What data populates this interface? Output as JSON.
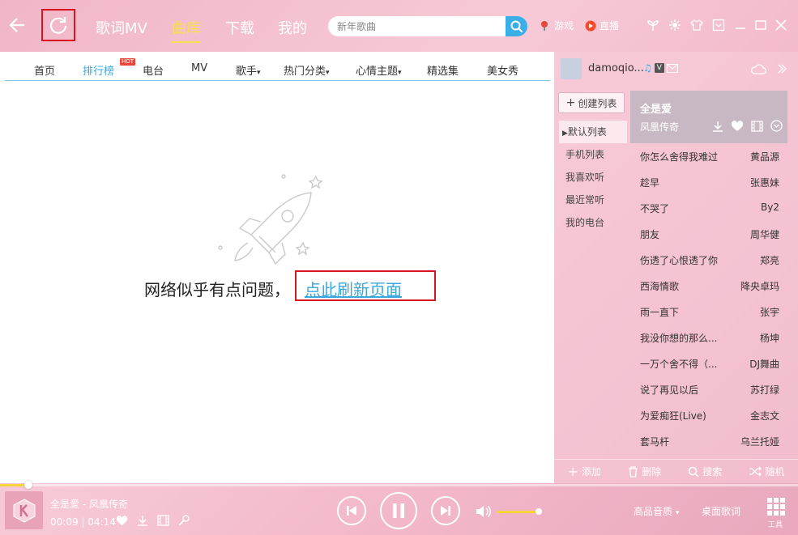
{
  "nav": {
    "tabs": [
      {
        "label": "歌词MV"
      },
      {
        "label": "曲库"
      },
      {
        "label": "下载"
      },
      {
        "label": "我的"
      }
    ]
  },
  "search": {
    "placeholder": "新年歌曲"
  },
  "top_links": {
    "games": "游戏",
    "live": "直播"
  },
  "subnav": {
    "items": [
      "首页",
      "排行榜",
      "电台",
      "MV",
      "歌手",
      "热门分类",
      "心情主题",
      "精选集",
      "美女秀"
    ],
    "hot_badge": "HOT"
  },
  "error": {
    "message": "网络似乎有点问题，",
    "refresh_link": "点此刷新页面"
  },
  "user": {
    "name": "damoqio...",
    "badge": "V"
  },
  "playlists": {
    "create_label": "创建列表",
    "items": [
      "默认列表",
      "手机列表",
      "我喜欢听",
      "最近常听",
      "我的电台"
    ]
  },
  "now_playing": {
    "title": "全是爱",
    "artist": "凤凰传奇"
  },
  "songs": [
    {
      "name": "你怎么舍得我难过",
      "artist": "黄品源"
    },
    {
      "name": "趁早",
      "artist": "张惠妹"
    },
    {
      "name": "不哭了",
      "artist": "By2"
    },
    {
      "name": "朋友",
      "artist": "周华健"
    },
    {
      "name": "伤透了心恨透了你",
      "artist": "郑亮"
    },
    {
      "name": "西海情歌",
      "artist": "降央卓玛"
    },
    {
      "name": "雨一直下",
      "artist": "张宇"
    },
    {
      "name": "我没你想的那么...",
      "artist": "杨坤"
    },
    {
      "name": "一万个舍不得（...",
      "artist": "DJ舞曲"
    },
    {
      "name": "说了再见以后",
      "artist": "苏打绿"
    },
    {
      "name": "为爱痴狂(Live)",
      "artist": "金志文"
    },
    {
      "name": "套马杆",
      "artist": "乌兰托娅"
    }
  ],
  "panel_actions": {
    "add": "添加",
    "delete": "删除",
    "search": "搜索",
    "random": "随机"
  },
  "player": {
    "track": "全是爱 - 凤凰传奇",
    "elapsed": "00:09",
    "total": "04:14",
    "progress": 0.036,
    "volume": 0.95,
    "quality": "高品音质",
    "desktop_lyric": "桌面歌词",
    "tools": "工具"
  },
  "colors": {
    "accent": "#3aa7dd",
    "highlight": "#d8141e",
    "active_tab": "#f7e04f"
  }
}
